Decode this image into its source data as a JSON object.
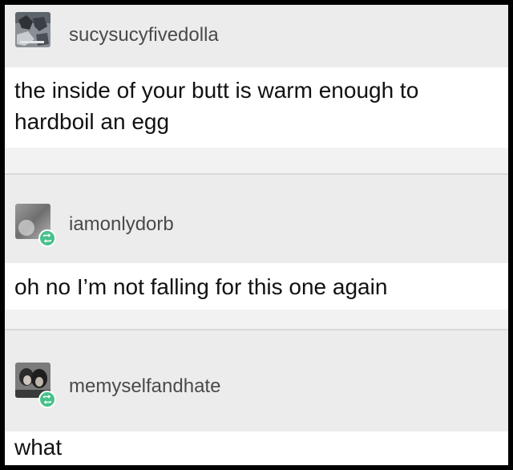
{
  "thread": {
    "posts": [
      {
        "username": "sucysucyfivedolla",
        "lines": [
          "the inside of your butt is warm enough to",
          "hardboil an egg"
        ],
        "avatar_icon": "user-avatar-icon",
        "reblog": false
      },
      {
        "username": "iamonlydorb",
        "lines": [
          "oh no I’m not falling for this one again"
        ],
        "avatar_icon": "user-avatar-icon",
        "reblog": true
      },
      {
        "username": "memyselfandhate",
        "lines": [
          "what"
        ],
        "avatar_icon": "user-avatar-icon",
        "reblog": true
      }
    ]
  },
  "colors": {
    "background": "#f2f2f2",
    "username": "#4a4a4a",
    "text": "#111111",
    "reblog_badge": "#47c28a"
  }
}
